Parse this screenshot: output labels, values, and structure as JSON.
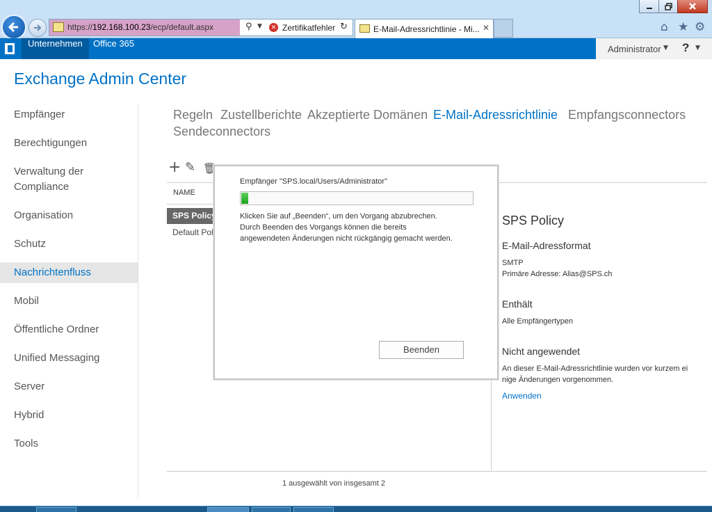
{
  "browser": {
    "url_scheme": "https://",
    "url_host": "192.168.100.23",
    "url_path": "/ecp/default.aspx",
    "cert_error": "Zertifikatfehler",
    "tab_title": "E-Mail-Adressrichtlinie - Mi...",
    "icons": [
      "back-arrow-icon",
      "forward-arrow-icon",
      "search-icon",
      "refresh-icon",
      "home-icon",
      "star-icon",
      "gear-icon"
    ]
  },
  "topbar": {
    "enterprise": "Unternehmen",
    "office365": "Office 365",
    "user": "Administrator",
    "help": "?"
  },
  "app": {
    "title": "Exchange Admin Center"
  },
  "sidebar": {
    "items": [
      {
        "label": "Empfänger"
      },
      {
        "label": "Berechtigungen"
      },
      {
        "label": "Verwaltung der"
      },
      {
        "label": "Compliance"
      },
      {
        "label": "Organisation"
      },
      {
        "label": "Schutz"
      },
      {
        "label": "Nachrichtenfluss"
      },
      {
        "label": "Mobil"
      },
      {
        "label": "Öffentliche Ordner"
      },
      {
        "label": "Unified Messaging"
      },
      {
        "label": "Server"
      },
      {
        "label": "Hybrid"
      },
      {
        "label": "Tools"
      }
    ],
    "selected": "Nachrichtenfluss"
  },
  "subnav": {
    "items": [
      {
        "label": "Regeln"
      },
      {
        "label": "Zustellberichte"
      },
      {
        "label": "Akzeptierte Domänen"
      },
      {
        "label": "E-Mail-Adressrichtlinie"
      },
      {
        "label": "Empfangsconnectors"
      },
      {
        "label": "Sendeconnectors"
      }
    ],
    "active": "E-Mail-Adressrichtlinie"
  },
  "list": {
    "column": "NAME",
    "rows": [
      {
        "name": "SPS Policy",
        "selected": true
      },
      {
        "name": "Default Policy",
        "selected": false
      }
    ],
    "status": "1 ausgewählt von insgesamt 2"
  },
  "detail": {
    "title": "SPS Policy",
    "format_heading": "E-Mail-Adressformat",
    "format_type": "SMTP",
    "primary_address": "Primäre Adresse: Alias@SPS.ch",
    "contains_heading": "Enthält",
    "contains_value": "Alle Empfängertypen",
    "not_applied_heading": "Nicht angewendet",
    "not_applied_line1": "An dieser E-Mail-Adressrichtlinie wurden vor kurzem ei",
    "not_applied_line2": "nige Änderungen vorgenommen.",
    "apply_link": "Anwenden"
  },
  "modal": {
    "title": "Empfänger \"SPS.local/Users/Administrator\"",
    "progress_percent": 3,
    "text_line1": "Klicken Sie auf „Beenden“, um den Vorgang abzubrechen.",
    "text_line2": "Durch Beenden des Vorgangs können die bereits",
    "text_line3": "angewendeten Änderungen nicht rückgängig gemacht werden.",
    "finish_button": "Beenden"
  },
  "colors": {
    "accent": "#0072c6",
    "progress": "#1ea21e",
    "selected_row": "#676767"
  }
}
